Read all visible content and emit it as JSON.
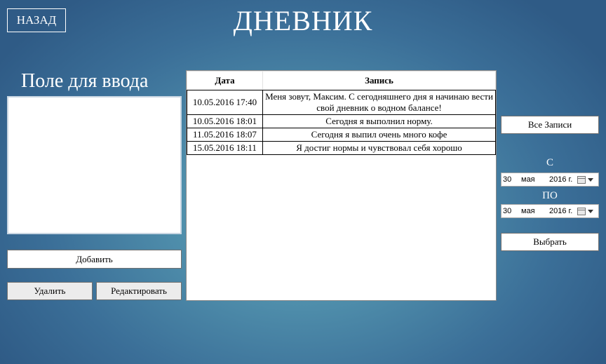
{
  "header": {
    "back_label": "НАЗАД",
    "title": "ДНЕВНИК"
  },
  "input_panel": {
    "label": "Поле для ввода",
    "value": "",
    "add_label": "Добавить",
    "delete_label": "Удалить",
    "edit_label": "Редактировать"
  },
  "table": {
    "columns": [
      "Дата",
      "Запись"
    ],
    "rows": [
      {
        "date": "10.05.2016 17:40",
        "entry": "Меня зовут, Максим. С сегодняшнего дня я начинаю вести свой дневник о водном балансе!"
      },
      {
        "date": "10.05.2016 18:01",
        "entry": "Сегодня я выполнил норму."
      },
      {
        "date": "11.05.2016 18:07",
        "entry": "Сегодня я выпил очень много кофе"
      },
      {
        "date": "15.05.2016 18:11",
        "entry": "Я достиг нормы и чувствовал себя хорошо"
      }
    ]
  },
  "filter": {
    "all_label": "Все Записи",
    "from_label": "С",
    "to_label": "ПО",
    "from_date": {
      "day": "30",
      "month": "мая",
      "year": "2016 г."
    },
    "to_date": {
      "day": "30",
      "month": "мая",
      "year": "2016 г."
    },
    "select_label": "Выбрать"
  },
  "icons": {
    "calendar": "calendar-icon",
    "dropdown": "chevron-down-icon"
  }
}
